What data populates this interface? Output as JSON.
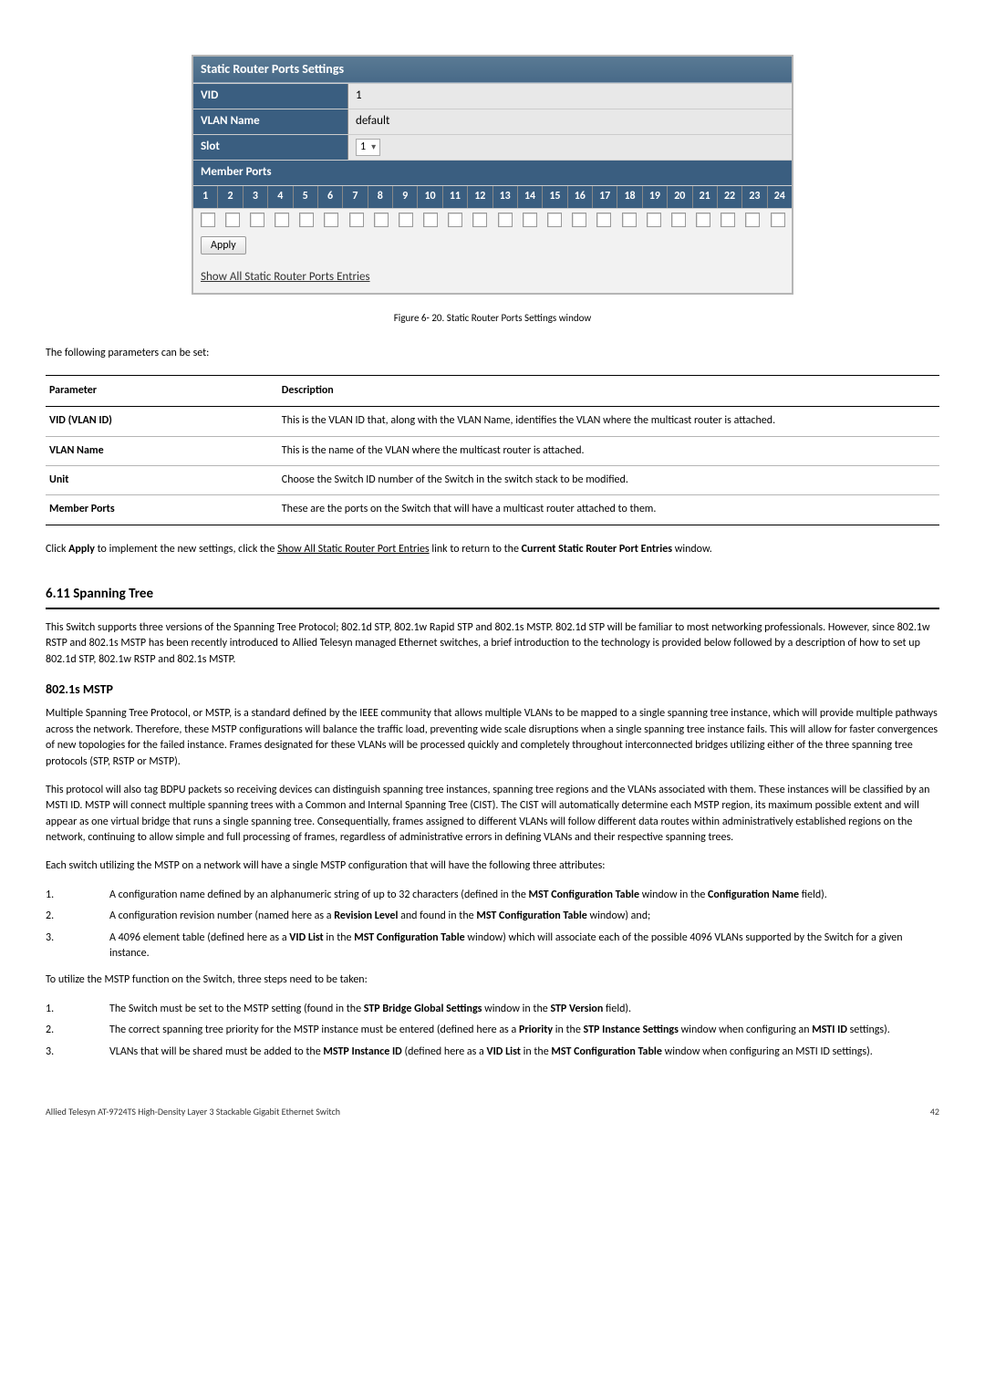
{
  "screenshot": {
    "panel_title": "Static Router Ports Settings",
    "rows": {
      "vid_label": "VID",
      "vid_value": "1",
      "vlan_name_label": "VLAN Name",
      "vlan_name_value": "default",
      "slot_label": "Slot",
      "slot_value": "1"
    },
    "member_ports_label": "Member Ports",
    "port_numbers": [
      "1",
      "2",
      "3",
      "4",
      "5",
      "6",
      "7",
      "8",
      "9",
      "10",
      "11",
      "12",
      "13",
      "14",
      "15",
      "16",
      "17",
      "18",
      "19",
      "20",
      "21",
      "22",
      "23",
      "24"
    ],
    "apply_button": "Apply",
    "show_all_link": "Show All Static Router Ports Entries"
  },
  "figure_caption": "Figure 6- 20. Static Router Ports Settings window",
  "intro_param_line": "The following parameters can be set:",
  "param_table": {
    "head_param": "Parameter",
    "head_desc": "Description",
    "rows": [
      {
        "name": "VID (VLAN ID)",
        "desc": "This is the VLAN ID that, along with the VLAN Name, identifies the VLAN where the multicast router is attached."
      },
      {
        "name": "VLAN Name",
        "desc": "This is the name of the VLAN where the multicast router is attached."
      },
      {
        "name": "Unit",
        "desc": "Choose the Switch ID number of the Switch in the switch stack to be modified."
      },
      {
        "name": "Member Ports",
        "desc": "These are the ports on the Switch that will have a multicast router attached to them."
      }
    ]
  },
  "after_table": {
    "pre": "Click ",
    "apply": "Apply",
    "mid1": " to implement the new settings, click the ",
    "linktext": "Show All Static Router Port Entries",
    "mid2": " link to return to the ",
    "strong_end": "Current Static Router Port Entries",
    "post": " window."
  },
  "section_heading": "6.11 Spanning Tree",
  "section_para": "This Switch supports three versions of the Spanning Tree Protocol; 802.1d STP, 802.1w Rapid STP and 802.1s MSTP.  802.1d STP will be familiar to most networking professionals. However, since 802.1w RSTP and 802.1s MSTP has been recently introduced to Allied Telesyn managed Ethernet switches, a brief introduction to the technology is provided below followed by a description of how to set up 802.1d STP, 802.1w RSTP and 802.1s MSTP.",
  "subsect_heading": "802.1s MSTP",
  "mstp_p1": "Multiple Spanning Tree Protocol, or MSTP, is a standard defined by the IEEE community that allows multiple VLANs to be mapped to a single spanning tree instance, which will provide multiple pathways across the network. Therefore, these MSTP configurations will balance the traffic load, preventing wide scale disruptions when a single spanning tree instance fails. This will allow for faster convergences of new topologies for the failed instance. Frames designated for these VLANs will be processed quickly and completely throughout interconnected bridges utilizing either of the three spanning tree protocols (STP, RSTP or MSTP).",
  "mstp_p2": "This protocol will also tag BDPU packets so receiving devices can distinguish spanning tree instances, spanning tree regions and the VLANs associated with them. These instances will be classified by an MSTI ID. MSTP will connect multiple spanning trees with a Common and Internal Spanning Tree (CIST). The CIST will automatically determine each MSTP region, its maximum possible extent and will appear as one virtual bridge that runs a single spanning tree. Consequentially, frames assigned to different VLANs will follow different data routes within administratively established regions on the network, continuing to allow simple and full processing of frames, regardless of administrative errors in defining VLANs and their respective spanning trees.",
  "mstp_p3": "Each switch utilizing the MSTP on a network will have a single MSTP configuration that will have the following three attributes:",
  "attr_list": [
    {
      "num": "1.",
      "pre": "A configuration name defined by an alphanumeric string of up to 32 characters (defined in the ",
      "b1": "MST Configuration Table",
      "mid": " window in the ",
      "b2": "Configuration Name",
      "post": " field)."
    },
    {
      "num": "2.",
      "pre": "A configuration revision number (named here as a ",
      "b1": "Revision Level",
      "mid": " and found in the ",
      "b2": "MST Configuration Table",
      "post": " window) and;"
    },
    {
      "num": "3.",
      "pre": "A 4096 element table (defined here as a ",
      "b1": "VID List",
      "mid": " in the ",
      "b2": "MST Configuration Table",
      "post": " window) which will associate each of the possible 4096 VLANs supported by the Switch for a given instance."
    }
  ],
  "utilize_line": "To utilize the MSTP function on the Switch, three steps need to be taken:",
  "steps_list": [
    {
      "num": "1.",
      "pre": "The Switch must be set to the MSTP setting (found in the ",
      "b1": "STP Bridge Global Settings",
      "mid": " window in the ",
      "b2": "STP Version",
      "post": " field)."
    },
    {
      "num": "2.",
      "pre": "The correct spanning tree priority for the MSTP instance must be entered (defined here as a ",
      "b1": "Priority",
      "mid": " in the ",
      "b2": "STP Instance Settings",
      "post": " window when configuring an ",
      "b3": "MSTI ID",
      "post2": " settings)."
    },
    {
      "num": "3.",
      "pre": "VLANs that will be shared must be added to the ",
      "b1": "MSTP Instance ID",
      "mid": " (defined here as a ",
      "b2": "VID List",
      "post": " in the ",
      "b3": "MST Configuration Table",
      "post2": " window when configuring an MSTI ID settings)."
    }
  ],
  "footer": {
    "left": "Allied Telesyn AT-9724TS High-Density Layer 3 Stackable Gigabit Ethernet Switch",
    "right": "42"
  }
}
